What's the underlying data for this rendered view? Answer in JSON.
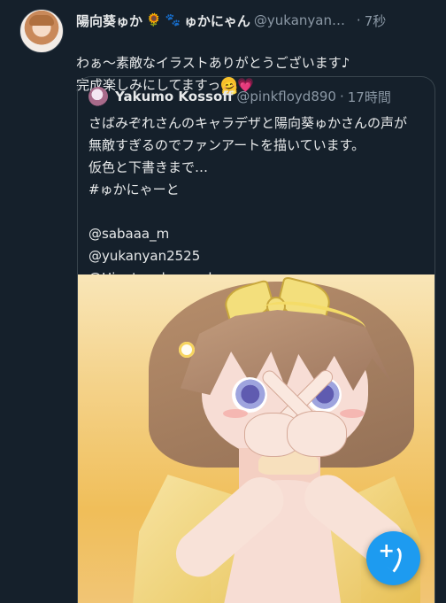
{
  "reply": {
    "author": {
      "name": "陽向葵ゅか",
      "name_emoji_1": "🌻",
      "name_emoji_2": "🐾",
      "name_suffix": "ゅかにゃん",
      "handle": "@yukanyan25...",
      "separator": "·",
      "time": "7秒"
    },
    "text": "わぁ～素敵なイラストありがとうございます♪\n完成楽しみにしてますっ",
    "emoji_1": "🤗",
    "emoji_2": "💗"
  },
  "quote": {
    "author": {
      "name": "Yakumo Kossoff",
      "handle": "@pinkfloyd890",
      "separator": "·",
      "time": "17時間"
    },
    "text": "さばみぞれさんのキャラデザと陽向葵ゅかさんの声が\n無敵すぎるのでファンアートを描いています。\n仮色と下書きまで…\n#ゅかにゃーと\n\n@sabaaa_m\n@yukanyan2525\n@Hinatayuka_work"
  },
  "icons": {
    "avatar": "avatar-image",
    "quote_avatar": "quote-avatar-image",
    "compose": "feather-plus-icon"
  },
  "colors": {
    "background": "#15202b",
    "primary_text": "#e7e9ea",
    "secondary_text": "#8b98a5",
    "accent": "#1d9bf0"
  }
}
